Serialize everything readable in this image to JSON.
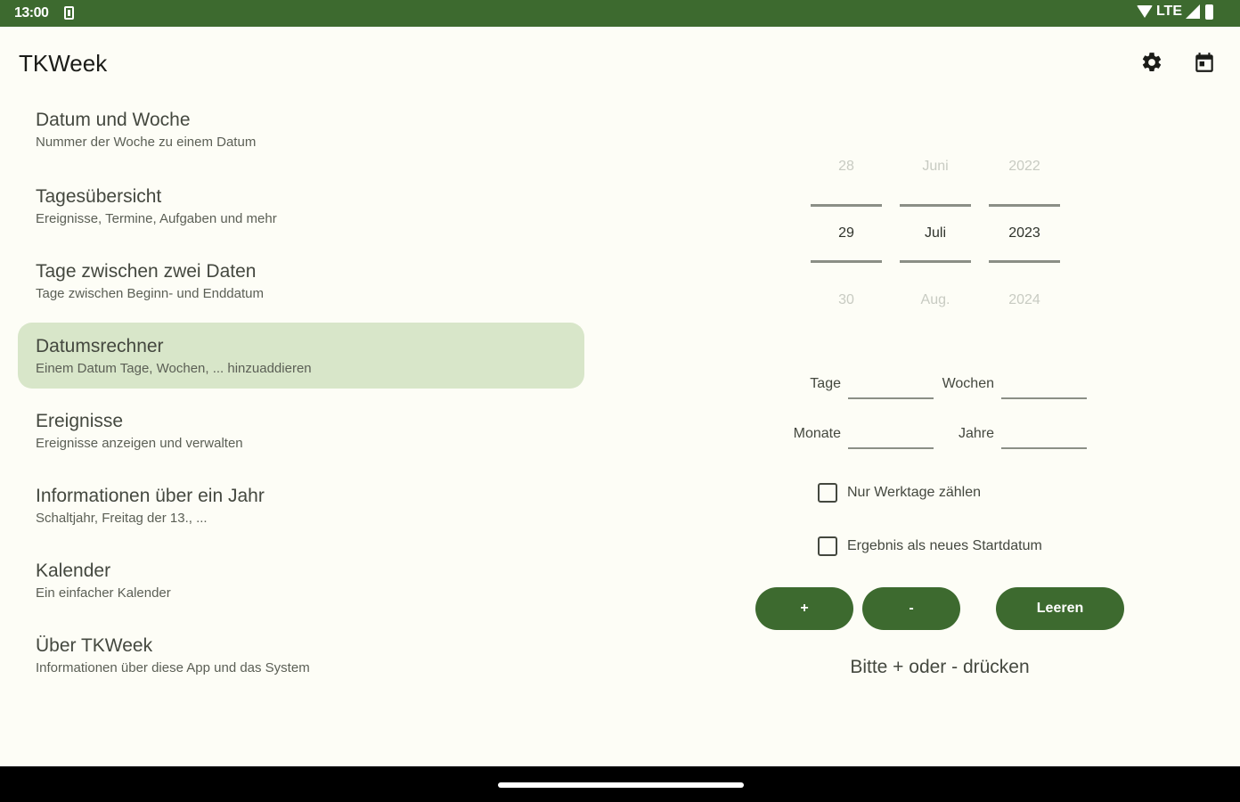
{
  "status_bar": {
    "time": "13:00",
    "network": "LTE"
  },
  "app": {
    "title": "TKWeek",
    "accent_color": "#3d6a2f",
    "selected_bg": "#d8e6c9"
  },
  "nav": {
    "items": [
      {
        "title": "Datum und Woche",
        "subtitle": "Nummer der Woche zu einem Datum"
      },
      {
        "title": "Tagesübersicht",
        "subtitle": "Ereignisse, Termine, Aufgaben und mehr"
      },
      {
        "title": "Tage zwischen zwei Daten",
        "subtitle": "Tage zwischen Beginn- und Enddatum"
      },
      {
        "title": "Datumsrechner",
        "subtitle": "Einem Datum Tage, Wochen, ... hinzuaddieren"
      },
      {
        "title": "Ereignisse",
        "subtitle": "Ereignisse anzeigen und verwalten"
      },
      {
        "title": "Informationen über ein Jahr",
        "subtitle": "Schaltjahr, Freitag der 13., ..."
      },
      {
        "title": "Kalender",
        "subtitle": "Ein einfacher Kalender"
      },
      {
        "title": "Über TKWeek",
        "subtitle": "Informationen über diese App und das System"
      }
    ]
  },
  "picker": {
    "day": {
      "prev": "28",
      "current": "29",
      "next": "30"
    },
    "month": {
      "prev": "Juni",
      "current": "Juli",
      "next": "Aug."
    },
    "year": {
      "prev": "2022",
      "current": "2023",
      "next": "2024"
    }
  },
  "fields": {
    "days_label": "Tage",
    "weeks_label": "Wochen",
    "months_label": "Monate",
    "years_label": "Jahre",
    "days_value": "",
    "weeks_value": "",
    "months_value": "",
    "years_value": ""
  },
  "options": {
    "workdays_label": "Nur Werktage zählen",
    "workdays_checked": false,
    "result_as_start_label": "Ergebnis als neues Startdatum",
    "result_as_start_checked": false
  },
  "buttons": {
    "plus_label": "+",
    "minus_label": "-",
    "clear_label": "Leeren"
  },
  "hint": "Bitte + oder - drücken"
}
